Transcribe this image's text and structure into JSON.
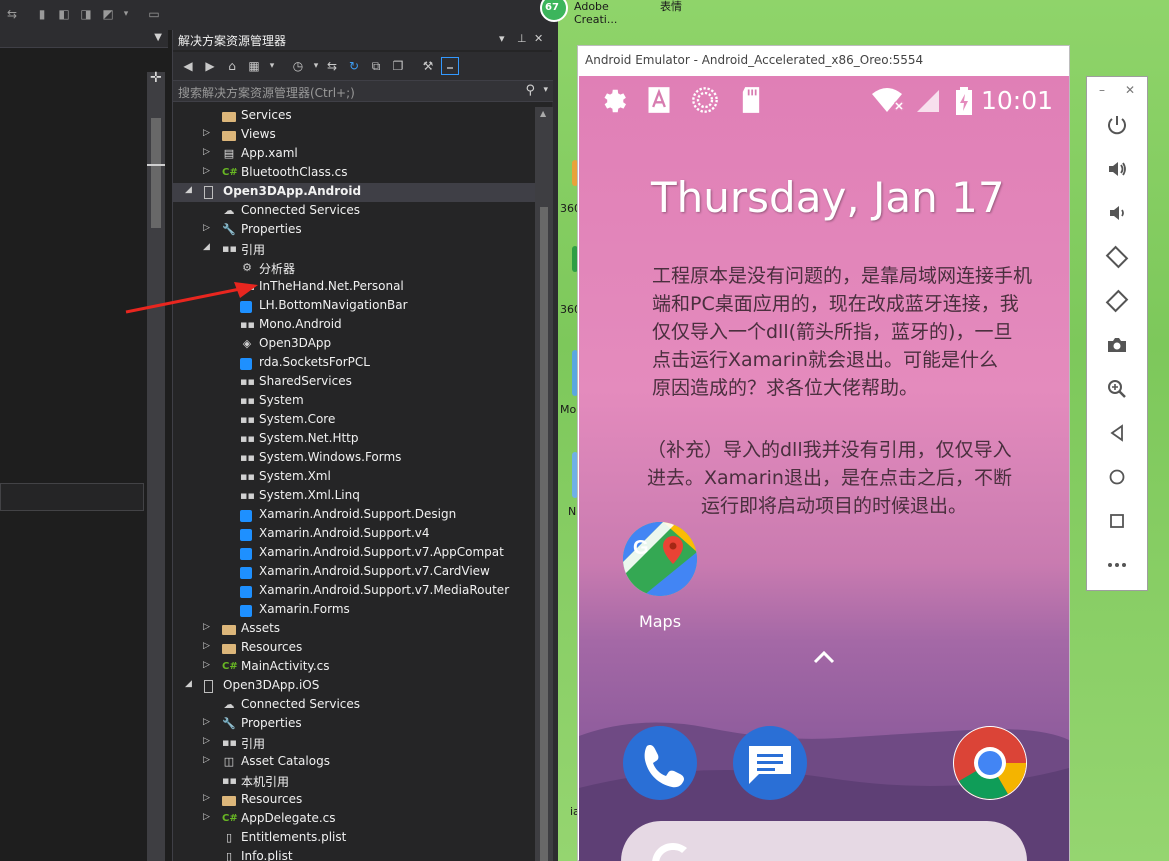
{
  "vs": {
    "solution_explorer": {
      "title": "解决方案资源管理器",
      "search_placeholder": "搜索解决方案资源管理器(Ctrl+;)",
      "window_controls": [
        "▾",
        "⊥",
        "✕"
      ],
      "tree": [
        {
          "label": "Services",
          "icon": "folder-icon",
          "expander": ""
        },
        {
          "label": "Views",
          "icon": "folder-icon",
          "expander": "collapsed"
        },
        {
          "label": "App.xaml",
          "icon": "xaml-file-icon",
          "expander": "collapsed"
        },
        {
          "label": "BluetoothClass.cs",
          "icon": "csharp-file-icon",
          "expander": "collapsed"
        },
        {
          "label": "Open3DApp.Android",
          "icon": "android-project-icon",
          "expander": "expanded",
          "bold": true,
          "selected": true
        },
        {
          "label": "Connected Services",
          "icon": "connected-services-icon",
          "expander": ""
        },
        {
          "label": "Properties",
          "icon": "wrench-icon",
          "expander": "collapsed"
        },
        {
          "label": "引用",
          "icon": "references-icon",
          "expander": "expanded"
        },
        {
          "label": "分析器",
          "icon": "analyzer-icon",
          "expander": ""
        },
        {
          "label": "InTheHand.Net.Personal",
          "icon": "reference-icon",
          "expander": ""
        },
        {
          "label": "LH.BottomNavigationBar",
          "icon": "nuget-reference-icon",
          "expander": ""
        },
        {
          "label": "Mono.Android",
          "icon": "reference-icon",
          "expander": ""
        },
        {
          "label": "Open3DApp",
          "icon": "project-reference-icon",
          "expander": ""
        },
        {
          "label": "rda.SocketsForPCL",
          "icon": "nuget-reference-icon",
          "expander": ""
        },
        {
          "label": "SharedServices",
          "icon": "reference-icon",
          "expander": ""
        },
        {
          "label": "System",
          "icon": "reference-icon",
          "expander": ""
        },
        {
          "label": "System.Core",
          "icon": "reference-icon",
          "expander": ""
        },
        {
          "label": "System.Net.Http",
          "icon": "reference-icon",
          "expander": ""
        },
        {
          "label": "System.Windows.Forms",
          "icon": "reference-icon",
          "expander": ""
        },
        {
          "label": "System.Xml",
          "icon": "reference-icon",
          "expander": ""
        },
        {
          "label": "System.Xml.Linq",
          "icon": "reference-icon",
          "expander": ""
        },
        {
          "label": "Xamarin.Android.Support.Design",
          "icon": "nuget-reference-icon",
          "expander": ""
        },
        {
          "label": "Xamarin.Android.Support.v4",
          "icon": "nuget-reference-icon",
          "expander": ""
        },
        {
          "label": "Xamarin.Android.Support.v7.AppCompat",
          "icon": "nuget-reference-icon",
          "expander": ""
        },
        {
          "label": "Xamarin.Android.Support.v7.CardView",
          "icon": "nuget-reference-icon",
          "expander": ""
        },
        {
          "label": "Xamarin.Android.Support.v7.MediaRouter",
          "icon": "nuget-reference-icon",
          "expander": ""
        },
        {
          "label": "Xamarin.Forms",
          "icon": "nuget-reference-icon",
          "expander": ""
        },
        {
          "label": "Assets",
          "icon": "folder-icon",
          "expander": "collapsed"
        },
        {
          "label": "Resources",
          "icon": "folder-icon",
          "expander": "collapsed"
        },
        {
          "label": "MainActivity.cs",
          "icon": "csharp-file-icon",
          "expander": "collapsed"
        },
        {
          "label": "Open3DApp.iOS",
          "icon": "ios-project-icon",
          "expander": "expanded"
        },
        {
          "label": "Connected Services",
          "icon": "connected-services-icon",
          "expander": ""
        },
        {
          "label": "Properties",
          "icon": "wrench-icon",
          "expander": "collapsed"
        },
        {
          "label": "引用",
          "icon": "references-icon",
          "expander": "collapsed"
        },
        {
          "label": "Asset Catalogs",
          "icon": "asset-catalog-icon",
          "expander": "collapsed"
        },
        {
          "label": "本机引用",
          "icon": "references-icon",
          "expander": ""
        },
        {
          "label": "Resources",
          "icon": "folder-icon",
          "expander": "collapsed"
        },
        {
          "label": "AppDelegate.cs",
          "icon": "csharp-file-icon",
          "expander": "collapsed"
        },
        {
          "label": "Entitlements.plist",
          "icon": "plist-file-icon",
          "expander": ""
        },
        {
          "label": "Info.plist",
          "icon": "plist-file-icon",
          "expander": ""
        }
      ]
    }
  },
  "desktop": {
    "badge": "67",
    "icons": [
      "Adobe Creati...",
      "表情"
    ],
    "partial_labels": [
      "360",
      "360",
      "Mo",
      "N",
      "ia"
    ]
  },
  "emulator": {
    "title": "Android Emulator - Android_Accelerated_x86_Oreo:5554",
    "clock": "10:01",
    "date": "Thursday, Jan 17",
    "note_lines": [
      "工程原本是没有问题的，是靠局域网连接手机",
      "端和PC桌面应用的，现在改成蓝牙连接，我",
      "仅仅导入一个dll(箭头所指，蓝牙的)，一旦",
      "点击运行Xamarin就会退出。可能是什么",
      "原因造成的？求各位大佬帮助。"
    ],
    "note2_lines": [
      "（补充）导入的dll我并没有引用，仅仅导入",
      "进去。Xamarin退出，是在点击之后，不断",
      "运行即将启动项目的时候退出。"
    ],
    "maps_label": "Maps",
    "side_toolbar": {
      "controls": [
        "–",
        "✕"
      ],
      "buttons": [
        "power-icon",
        "volume-up-icon",
        "volume-down-icon",
        "rotate-left-icon",
        "rotate-right-icon",
        "camera-icon",
        "zoom-icon",
        "back-icon",
        "home-icon",
        "overview-icon",
        "more-icon"
      ]
    }
  },
  "colors": {
    "vs_bg": "#252526",
    "selection": "#3f3f46",
    "annotation_arrow": "#e8261f",
    "desktop_green": "#8fd46a",
    "lockscreen_pink": "#e48bbd"
  }
}
